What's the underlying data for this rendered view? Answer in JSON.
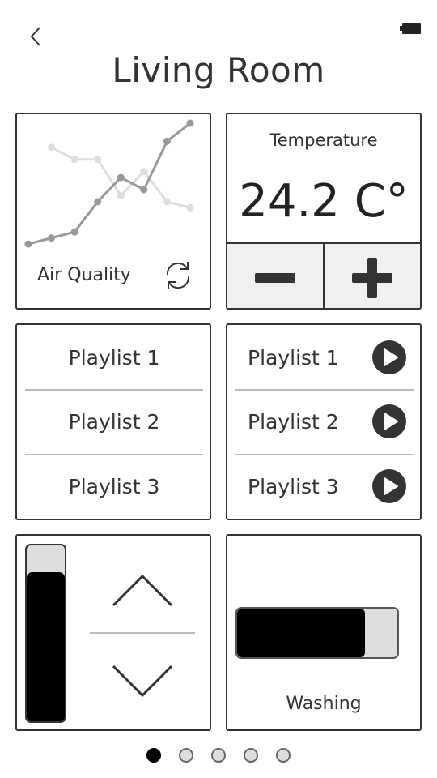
{
  "header": {
    "title": "Living Room",
    "back_icon": "chevron-left-icon",
    "battery_icon": "battery-icon"
  },
  "air_quality": {
    "label": "Air Quality",
    "refresh_icon": "refresh-icon",
    "chart_data": {
      "type": "line",
      "x": [
        1,
        2,
        3,
        4,
        5,
        6,
        7,
        8,
        9
      ],
      "series": [
        {
          "values": [
            2,
            3,
            4,
            9,
            13,
            11,
            19,
            22
          ],
          "x": [
            1,
            2,
            3,
            4,
            5,
            6,
            7,
            8
          ],
          "color": "#999999"
        },
        {
          "values": [
            18,
            16,
            16,
            10,
            14,
            9,
            8
          ],
          "x": [
            2,
            3,
            4,
            5,
            6,
            7,
            8
          ],
          "color": "#dddddd"
        }
      ],
      "grid": false
    }
  },
  "temperature": {
    "label": "Temperature",
    "value": "24.2 C°",
    "decrease_icon": "minus-icon",
    "increase_icon": "plus-icon"
  },
  "playlists_left": {
    "items": [
      {
        "label": "Playlist 1"
      },
      {
        "label": "Playlist 2"
      },
      {
        "label": "Playlist 3"
      }
    ]
  },
  "playlists_right": {
    "items": [
      {
        "label": "Playlist 1",
        "icon": "play-icon"
      },
      {
        "label": "Playlist 2",
        "icon": "play-icon"
      },
      {
        "label": "Playlist 3",
        "icon": "play-icon"
      }
    ]
  },
  "volume": {
    "level": 0.85,
    "up_icon": "chevron-up-icon",
    "down_icon": "chevron-down-icon"
  },
  "washing": {
    "label": "Washing",
    "progress": 0.8
  },
  "pager": {
    "count": 5,
    "active_index": 0
  }
}
